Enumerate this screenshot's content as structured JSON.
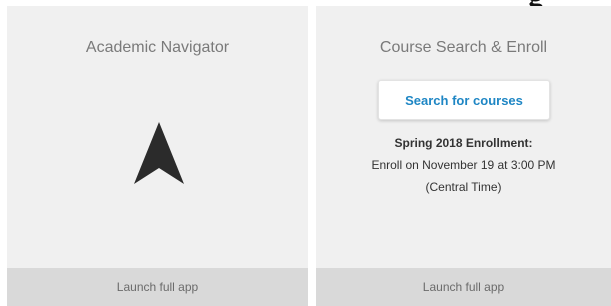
{
  "page": {
    "top_partial_text": "g"
  },
  "cards": [
    {
      "title": "Academic Navigator",
      "icon": "navigation-arrow-icon",
      "footer": "Launch full app"
    },
    {
      "title": "Course Search & Enroll",
      "search_button": "Search for courses",
      "enrollment": {
        "heading": "Spring 2018 Enrollment:",
        "line1": "Enroll on November 19 at 3:00 PM",
        "line2": "(Central Time)"
      },
      "footer": "Launch full app"
    }
  ],
  "colors": {
    "card_background": "#f0f0f0",
    "footer_background": "#d9d9d9",
    "link_blue": "#1e86c4",
    "icon_dark": "#2b2b2b"
  }
}
